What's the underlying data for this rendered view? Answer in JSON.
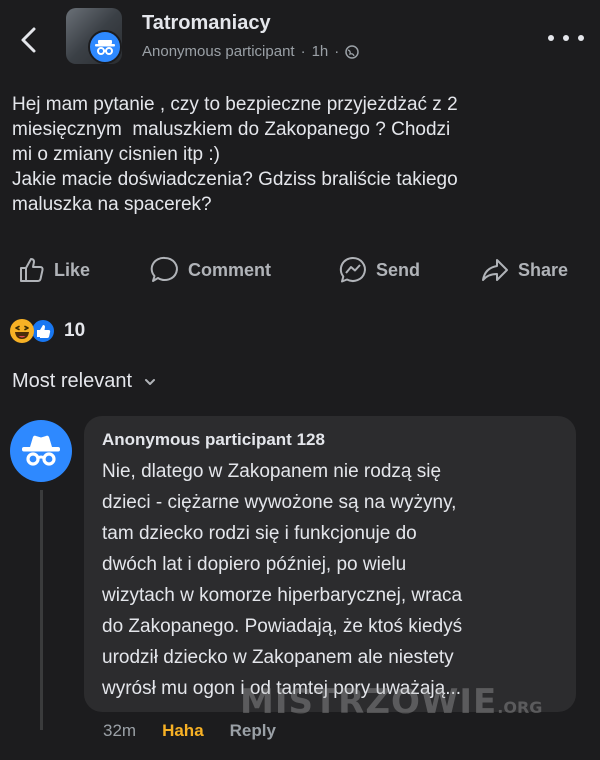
{
  "header": {
    "group_name": "Tatromaniacy",
    "author": "Anonymous participant",
    "separator": "·",
    "time": "1h"
  },
  "post": {
    "lines": [
      "Hej mam pytanie , czy to bezpieczne przyjeżdżać z 2",
      "miesięcznym  maluszkiem do Zakopanego ? Chodzi",
      "mi o zmiany cisnien itp :)",
      "Jakie macie doświadczenia? Gdziss braliście takiego",
      "maluszka na spacerek?"
    ]
  },
  "actions": {
    "like": "Like",
    "comment": "Comment",
    "send": "Send",
    "share": "Share"
  },
  "reactions": {
    "count": "10",
    "types": [
      "haha",
      "like"
    ]
  },
  "sort": {
    "label": "Most relevant"
  },
  "comment": {
    "author": "Anonymous participant 128",
    "lines": [
      "Nie, dlatego w Zakopanem nie rodzą się",
      "dzieci - ciężarne wywożone są na wyżyny,",
      "tam dziecko rodzi się i funkcjonuje do",
      "dwóch lat i dopiero później, po wielu",
      "wizytach w komorze hiperbarycznej, wraca",
      "do Zakopanego. Powiadają, że ktoś kiedyś",
      "urodził dziecko w Zakopanem ale niestety",
      "wyrósł mu ogon i od tamtej pory uważają..."
    ],
    "time": "32m",
    "reaction": "Haha",
    "reply": "Reply"
  },
  "watermark": {
    "text": "MISTRZOWIE",
    "suffix": ".ORG"
  },
  "colors": {
    "background": "#1c1c1e",
    "bubble": "#2c2c2e",
    "accent": "#2e89ff",
    "haha": "#f7b125"
  }
}
